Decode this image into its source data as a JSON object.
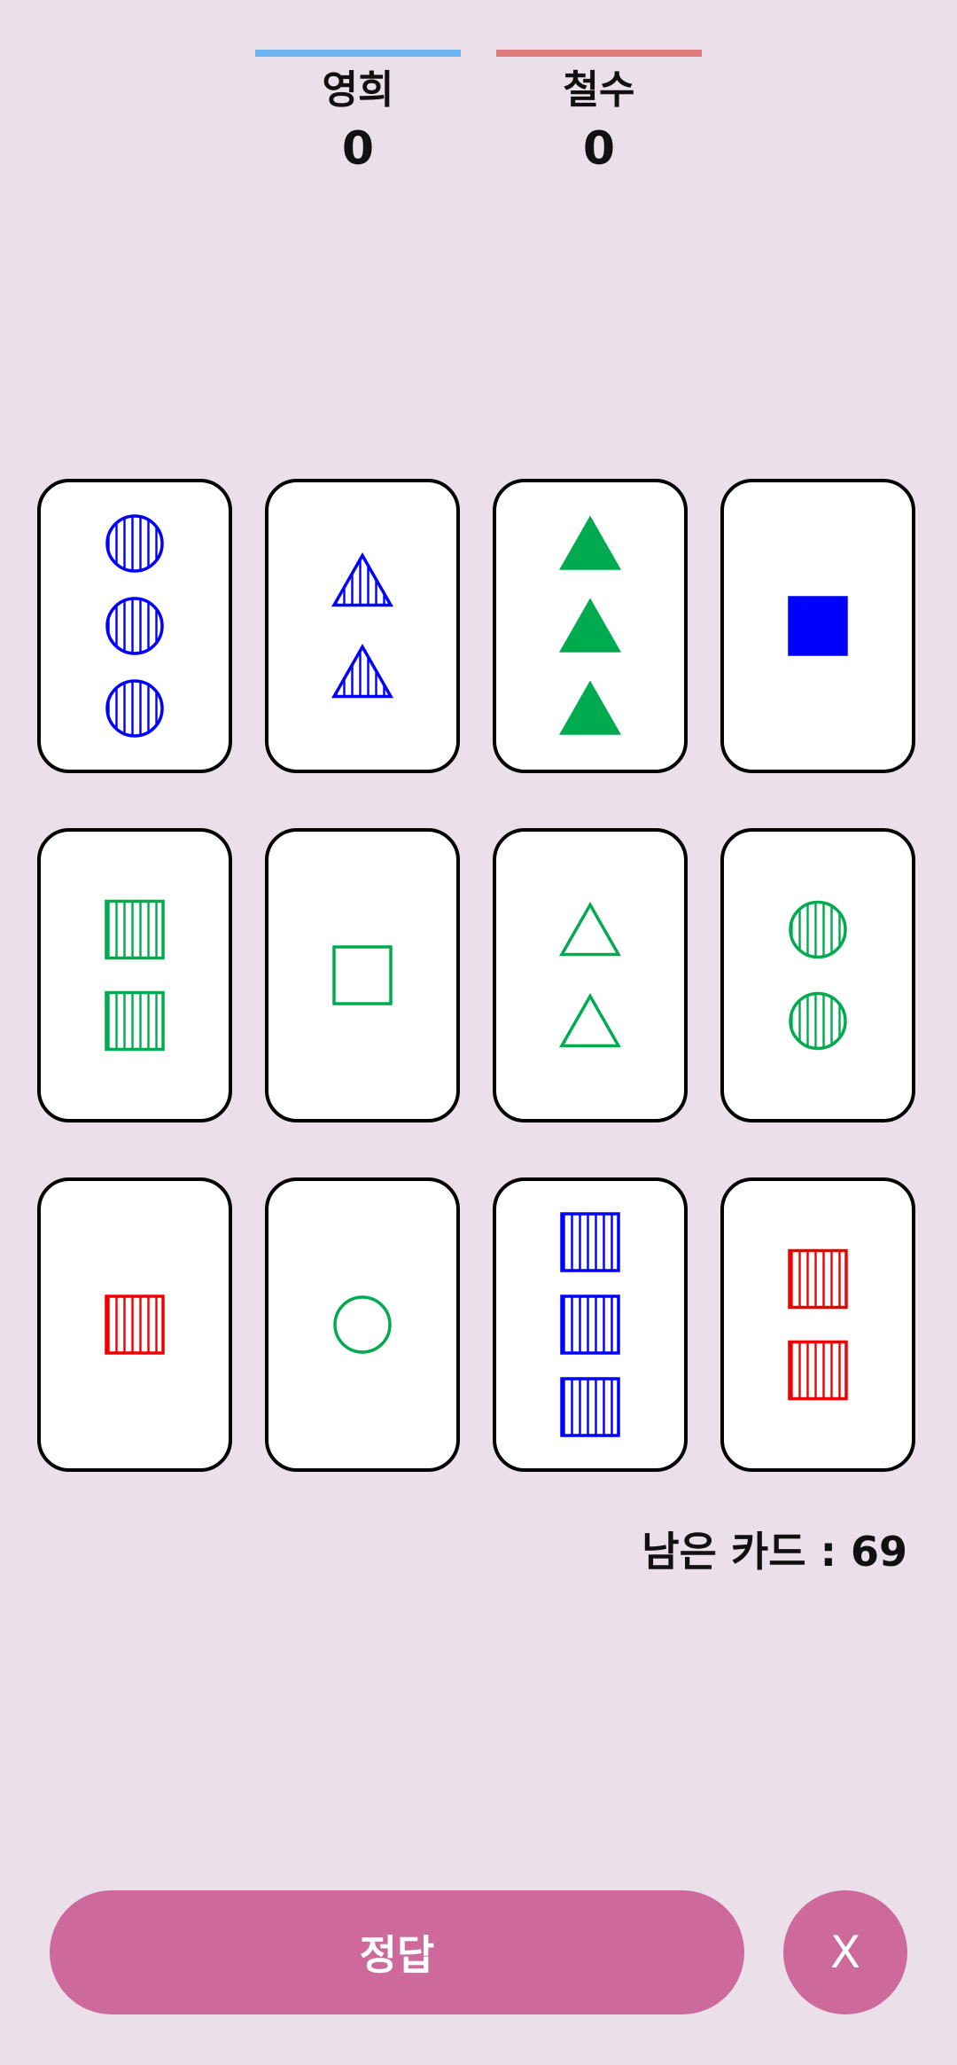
{
  "players": [
    {
      "name": "영희",
      "score": "0",
      "color": "#6cb4f0"
    },
    {
      "name": "철수",
      "score": "0",
      "color": "#e07b7b"
    }
  ],
  "colors": {
    "blue": "#0000ff",
    "green": "#00aa4f",
    "red": "#ee0000"
  },
  "cards": [
    {
      "count": 3,
      "shape": "circle",
      "fill": "striped",
      "color": "blue"
    },
    {
      "count": 2,
      "shape": "triangle",
      "fill": "striped",
      "color": "blue"
    },
    {
      "count": 3,
      "shape": "triangle",
      "fill": "solid",
      "color": "green"
    },
    {
      "count": 1,
      "shape": "square",
      "fill": "solid",
      "color": "blue"
    },
    {
      "count": 2,
      "shape": "square",
      "fill": "striped",
      "color": "green"
    },
    {
      "count": 1,
      "shape": "square",
      "fill": "empty",
      "color": "green"
    },
    {
      "count": 2,
      "shape": "triangle",
      "fill": "empty",
      "color": "green"
    },
    {
      "count": 2,
      "shape": "circle",
      "fill": "striped",
      "color": "green"
    },
    {
      "count": 1,
      "shape": "square",
      "fill": "striped",
      "color": "red"
    },
    {
      "count": 1,
      "shape": "circle",
      "fill": "empty",
      "color": "green"
    },
    {
      "count": 3,
      "shape": "square",
      "fill": "striped",
      "color": "blue"
    },
    {
      "count": 2,
      "shape": "square",
      "fill": "striped",
      "color": "red"
    }
  ],
  "remaining_text": "남은 카드 : 69",
  "buttons": {
    "answer": "정답",
    "close": "X"
  }
}
